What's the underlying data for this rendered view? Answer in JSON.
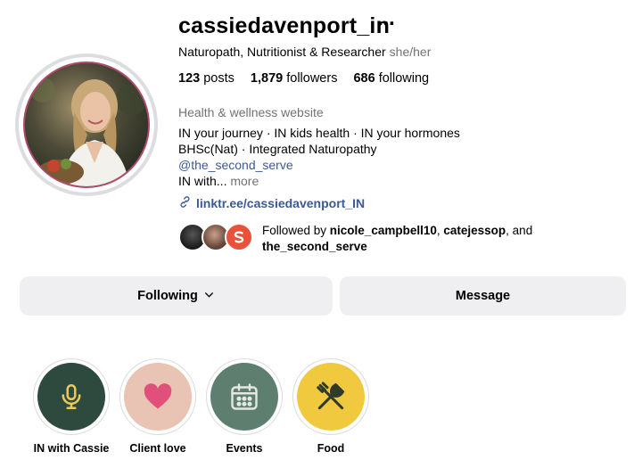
{
  "profile": {
    "username": "cassiedavenport_in",
    "more_icon": "⋯",
    "category": "Naturopath, Nutritionist & Researcher",
    "pronouns": "she/her",
    "stats": {
      "posts_count": "123",
      "posts_label": "posts",
      "followers_count": "1,879",
      "followers_label": "followers",
      "following_count": "686",
      "following_label": "following"
    },
    "bio": {
      "category_label": "Health & wellness website",
      "line1": "IN your journey · IN kids health · IN your hormones",
      "line2": "BHSc(Nat) · Integrated Naturopathy",
      "handle": "@the_second_serve",
      "line4": "IN with...",
      "more": " more"
    },
    "website": "linktr.ee/cassiedavenport_IN",
    "followed_by": {
      "prefix": "Followed by ",
      "user1": "nicole_campbell10",
      "sep": ", ",
      "user2": "catejessop",
      "and": ", and",
      "user3": "the_second_serve"
    }
  },
  "actions": {
    "following_label": "Following",
    "message_label": "Message"
  },
  "highlights": [
    {
      "label": "IN with Cassie",
      "icon": "microphone-icon",
      "bg": "#2e4a3e",
      "fg": "#e8c85a"
    },
    {
      "label": "Client love",
      "icon": "heart-icon",
      "bg": "#e9c4b4",
      "fg": "#e0507a"
    },
    {
      "label": "Events",
      "icon": "calendar-icon",
      "bg": "#5e7f6f",
      "fg": "#e4e8e2"
    },
    {
      "label": "Food",
      "icon": "fork-knife-icon",
      "bg": "#f1c93f",
      "fg": "#2e3b2a"
    }
  ],
  "colors": {
    "link": "#3b5998",
    "button_bg": "#efeff2",
    "secondary_text": "#737373",
    "avatar_border": "#b04a6c"
  }
}
